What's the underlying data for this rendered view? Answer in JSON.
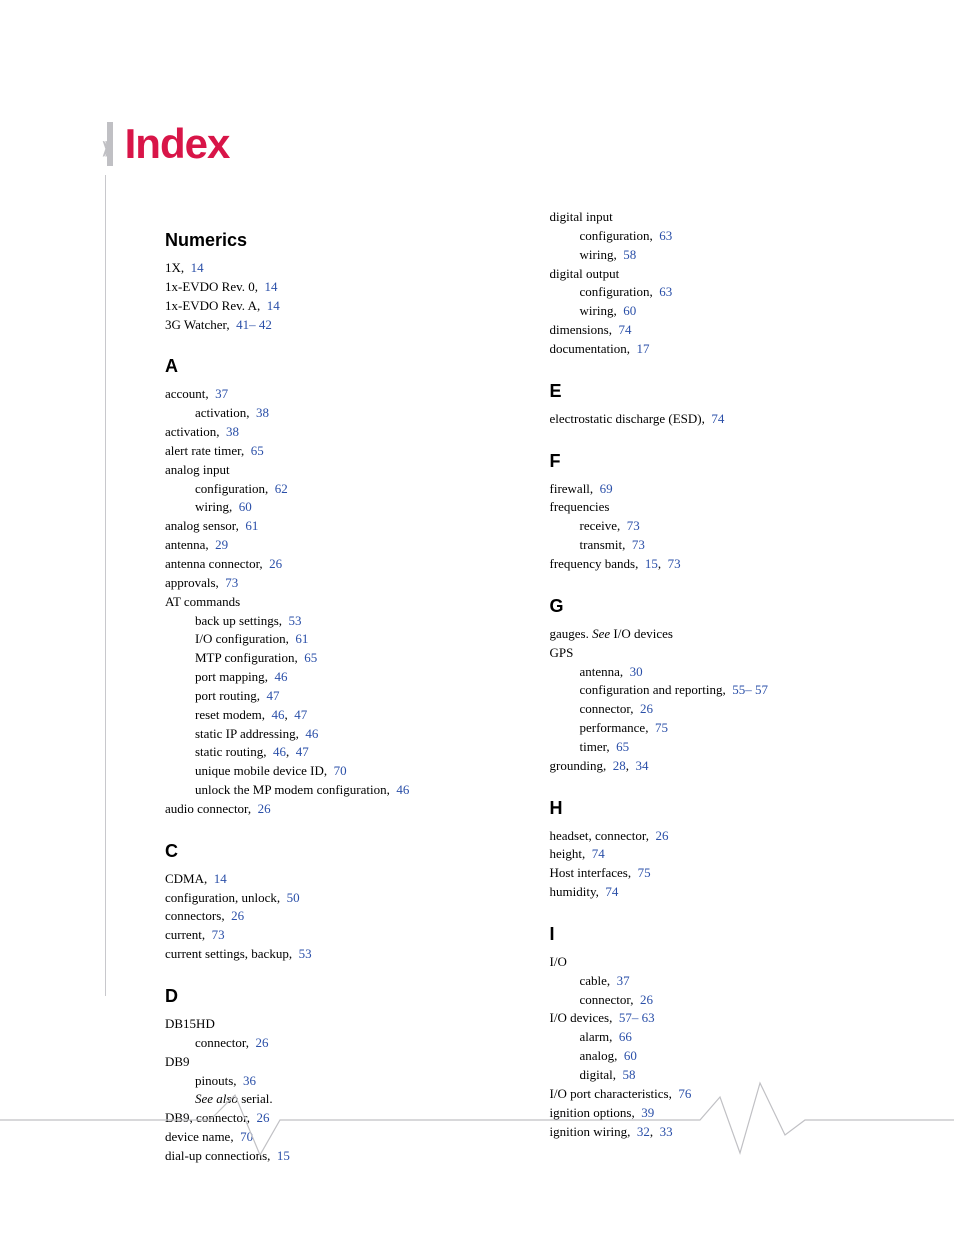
{
  "title": "Index",
  "left_col": [
    {
      "type": "head",
      "text": "Numerics"
    },
    {
      "type": "entry",
      "text": "1X",
      "refs": [
        "14"
      ]
    },
    {
      "type": "entry",
      "text": "1x-EVDO Rev. 0",
      "refs": [
        "14"
      ]
    },
    {
      "type": "entry",
      "text": "1x-EVDO Rev. A",
      "refs": [
        "14"
      ]
    },
    {
      "type": "entry",
      "text": "3G Watcher",
      "refs": [
        "41– 42"
      ]
    },
    {
      "type": "head",
      "text": "A"
    },
    {
      "type": "entry",
      "text": "account",
      "refs": [
        "37"
      ]
    },
    {
      "type": "sub",
      "text": "activation",
      "refs": [
        "38"
      ]
    },
    {
      "type": "entry",
      "text": "activation",
      "refs": [
        "38"
      ]
    },
    {
      "type": "entry",
      "text": "alert rate timer",
      "refs": [
        "65"
      ]
    },
    {
      "type": "entry",
      "text": "analog input",
      "refs": []
    },
    {
      "type": "sub",
      "text": "configuration",
      "refs": [
        "62"
      ]
    },
    {
      "type": "sub",
      "text": "wiring",
      "refs": [
        "60"
      ]
    },
    {
      "type": "entry",
      "text": "analog sensor",
      "refs": [
        "61"
      ]
    },
    {
      "type": "entry",
      "text": "antenna",
      "refs": [
        "29"
      ]
    },
    {
      "type": "entry",
      "text": "antenna connector",
      "refs": [
        "26"
      ]
    },
    {
      "type": "entry",
      "text": "approvals",
      "refs": [
        "73"
      ]
    },
    {
      "type": "entry",
      "text": "AT commands",
      "refs": []
    },
    {
      "type": "sub",
      "text": "back up settings",
      "refs": [
        "53"
      ]
    },
    {
      "type": "sub",
      "text": "I/O configuration",
      "refs": [
        "61"
      ]
    },
    {
      "type": "sub",
      "text": "MTP configuration",
      "refs": [
        "65"
      ]
    },
    {
      "type": "sub",
      "text": "port mapping",
      "refs": [
        "46"
      ]
    },
    {
      "type": "sub",
      "text": "port routing",
      "refs": [
        "47"
      ]
    },
    {
      "type": "sub",
      "text": "reset modem",
      "refs": [
        "46",
        "47"
      ]
    },
    {
      "type": "sub",
      "text": "static IP addressing",
      "refs": [
        "46"
      ]
    },
    {
      "type": "sub",
      "text": "static routing",
      "refs": [
        "46",
        "47"
      ]
    },
    {
      "type": "sub",
      "text": "unique mobile device ID",
      "refs": [
        "70"
      ]
    },
    {
      "type": "sub",
      "text": "unlock the MP modem configuration",
      "refs": [
        "46"
      ]
    },
    {
      "type": "entry",
      "text": "audio connector",
      "refs": [
        "26"
      ]
    },
    {
      "type": "head",
      "text": "C"
    },
    {
      "type": "entry",
      "text": "CDMA",
      "refs": [
        "14"
      ]
    },
    {
      "type": "entry",
      "text": "configuration, unlock",
      "refs": [
        "50"
      ]
    },
    {
      "type": "entry",
      "text": "connectors",
      "refs": [
        "26"
      ]
    },
    {
      "type": "entry",
      "text": "current",
      "refs": [
        "73"
      ]
    },
    {
      "type": "entry",
      "text": "current settings, backup",
      "refs": [
        "53"
      ]
    },
    {
      "type": "head",
      "text": "D"
    },
    {
      "type": "entry",
      "text": "DB15HD",
      "refs": []
    },
    {
      "type": "sub",
      "text": "connector",
      "refs": [
        "26"
      ]
    },
    {
      "type": "entry",
      "text": "DB9",
      "refs": []
    },
    {
      "type": "sub",
      "text": "pinouts",
      "refs": [
        "36"
      ]
    },
    {
      "type": "sub",
      "italic": true,
      "text": "See also",
      "after": " serial.",
      "refs": []
    },
    {
      "type": "entry",
      "text": "DB9, connector",
      "refs": [
        "26"
      ]
    },
    {
      "type": "entry",
      "text": "device name",
      "refs": [
        "70"
      ]
    },
    {
      "type": "entry",
      "text": "dial-up connections",
      "refs": [
        "15"
      ]
    }
  ],
  "right_col": [
    {
      "type": "entry",
      "text": "digital input",
      "refs": []
    },
    {
      "type": "sub",
      "text": "configuration",
      "refs": [
        "63"
      ]
    },
    {
      "type": "sub",
      "text": "wiring",
      "refs": [
        "58"
      ]
    },
    {
      "type": "entry",
      "text": "digital output",
      "refs": []
    },
    {
      "type": "sub",
      "text": "configuration",
      "refs": [
        "63"
      ]
    },
    {
      "type": "sub",
      "text": "wiring",
      "refs": [
        "60"
      ]
    },
    {
      "type": "entry",
      "text": "dimensions",
      "refs": [
        "74"
      ]
    },
    {
      "type": "entry",
      "text": "documentation",
      "refs": [
        "17"
      ]
    },
    {
      "type": "head",
      "text": "E"
    },
    {
      "type": "entry",
      "text": "electrostatic discharge (ESD)",
      "refs": [
        "74"
      ]
    },
    {
      "type": "head",
      "text": "F"
    },
    {
      "type": "entry",
      "text": "firewall",
      "refs": [
        "69"
      ]
    },
    {
      "type": "entry",
      "text": "frequencies",
      "refs": []
    },
    {
      "type": "sub",
      "text": "receive",
      "refs": [
        "73"
      ]
    },
    {
      "type": "sub",
      "text": "transmit",
      "refs": [
        "73"
      ]
    },
    {
      "type": "entry",
      "text": "frequency bands",
      "refs": [
        "15",
        "73"
      ]
    },
    {
      "type": "head",
      "text": "G"
    },
    {
      "type": "entry",
      "text": "gauges.",
      "italic_after": " See",
      "after": " I/O devices",
      "refs": []
    },
    {
      "type": "entry",
      "text": "GPS",
      "refs": []
    },
    {
      "type": "sub",
      "text": "antenna",
      "refs": [
        "30"
      ]
    },
    {
      "type": "sub",
      "text": "configuration and reporting",
      "refs": [
        "55– 57"
      ]
    },
    {
      "type": "sub",
      "text": "connector",
      "refs": [
        "26"
      ]
    },
    {
      "type": "sub",
      "text": "performance",
      "refs": [
        "75"
      ]
    },
    {
      "type": "sub",
      "text": "timer",
      "refs": [
        "65"
      ]
    },
    {
      "type": "entry",
      "text": "grounding",
      "refs": [
        "28",
        "34"
      ]
    },
    {
      "type": "head",
      "text": "H"
    },
    {
      "type": "entry",
      "text": "headset, connector",
      "refs": [
        "26"
      ]
    },
    {
      "type": "entry",
      "text": "height",
      "refs": [
        "74"
      ]
    },
    {
      "type": "entry",
      "text": "Host interfaces",
      "refs": [
        "75"
      ]
    },
    {
      "type": "entry",
      "text": "humidity",
      "refs": [
        "74"
      ]
    },
    {
      "type": "head",
      "text": "I"
    },
    {
      "type": "entry",
      "text": "I/O",
      "refs": []
    },
    {
      "type": "sub",
      "text": "cable",
      "refs": [
        "37"
      ]
    },
    {
      "type": "sub",
      "text": "connector",
      "refs": [
        "26"
      ]
    },
    {
      "type": "entry",
      "text": "I/O devices",
      "refs": [
        "57– 63"
      ]
    },
    {
      "type": "sub",
      "text": "alarm",
      "refs": [
        "66"
      ]
    },
    {
      "type": "sub",
      "text": "analog",
      "refs": [
        "60"
      ]
    },
    {
      "type": "sub",
      "text": "digital",
      "refs": [
        "58"
      ]
    },
    {
      "type": "entry",
      "text": "I/O port characteristics",
      "refs": [
        "76"
      ]
    },
    {
      "type": "entry",
      "text": "ignition options",
      "refs": [
        "39"
      ]
    },
    {
      "type": "entry",
      "text": "ignition wiring",
      "refs": [
        "32",
        "33"
      ]
    }
  ]
}
